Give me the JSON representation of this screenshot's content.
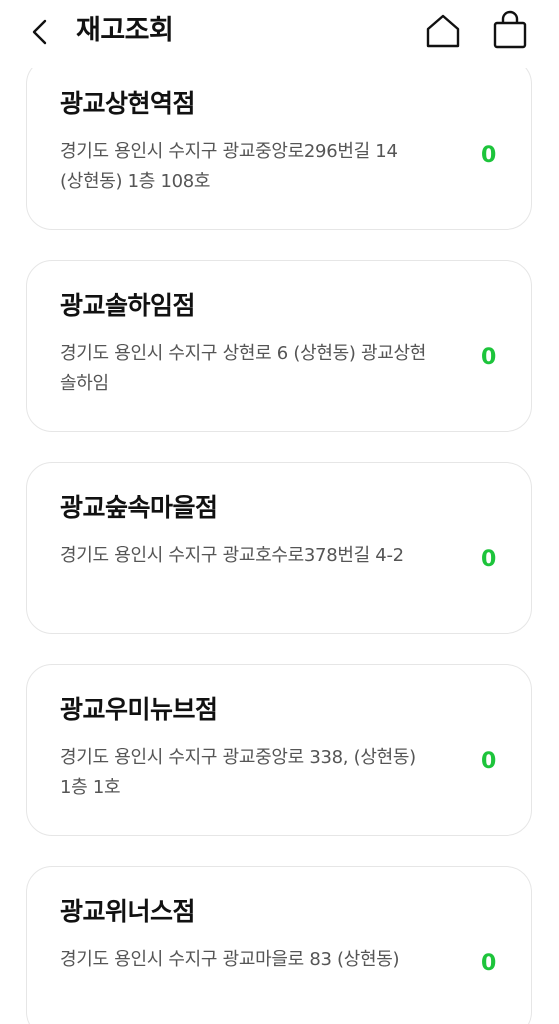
{
  "header": {
    "title": "재고조회",
    "back_icon": "chevron-left-icon",
    "home_icon": "home-icon",
    "bag_icon": "shopping-bag-icon"
  },
  "colors": {
    "stock": "#1dc43b",
    "card_border": "#e6e6e6",
    "address_text": "#555555"
  },
  "stores": [
    {
      "name": "광교상현역점",
      "address": "경기도 용인시 수지구 광교중앙로296번길 14 (상현동) 1층 108호",
      "stock": "0"
    },
    {
      "name": "광교솔하임점",
      "address": "경기도 용인시 수지구 상현로 6 (상현동) 광교상현 솔하임",
      "stock": "0"
    },
    {
      "name": "광교숲속마을점",
      "address": "경기도 용인시 수지구 광교호수로378번길 4-2",
      "stock": "0"
    },
    {
      "name": "광교우미뉴브점",
      "address": "경기도 용인시 수지구 광교중앙로 338, (상현동) 1층 1호",
      "stock": "0"
    },
    {
      "name": "광교위너스점",
      "address": "경기도 용인시 수지구 광교마을로 83 (상현동)",
      "stock": "0"
    }
  ]
}
